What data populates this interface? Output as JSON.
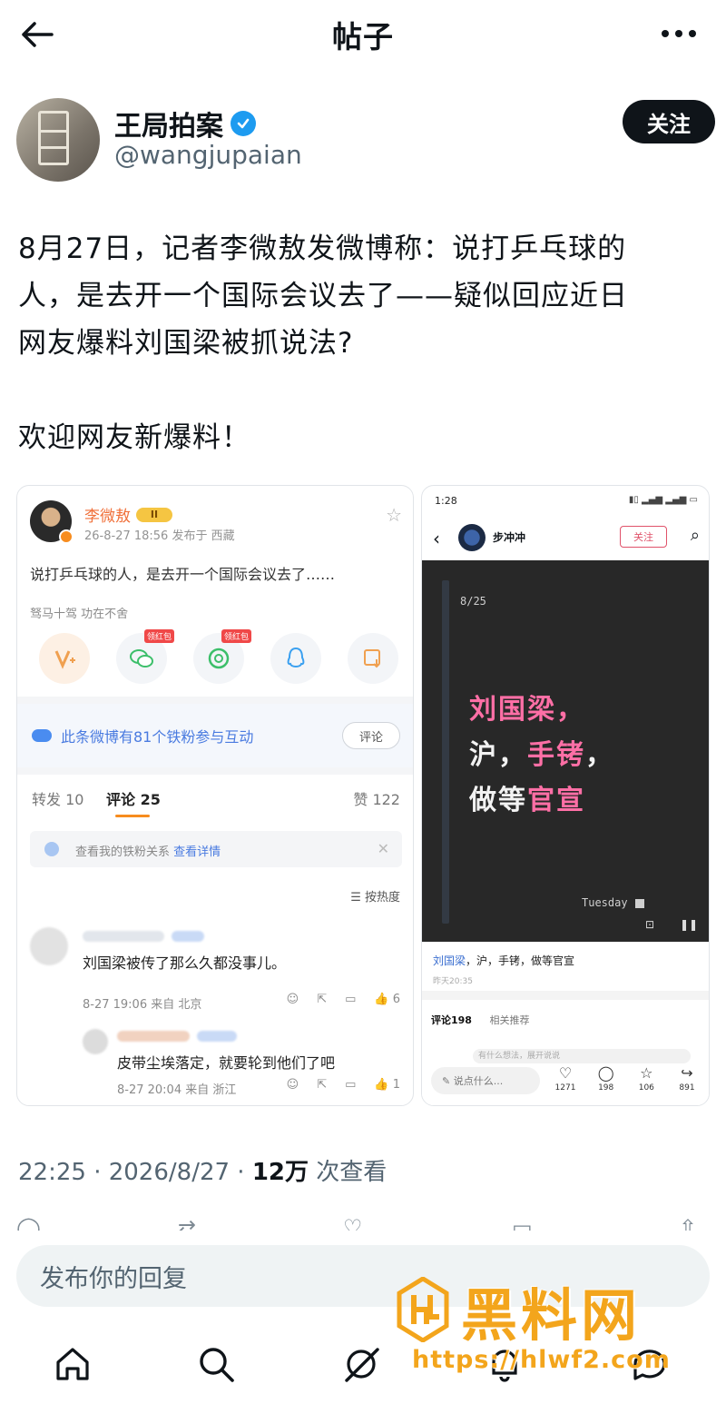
{
  "topbar": {
    "title": "帖子"
  },
  "author": {
    "name": "王局拍案",
    "handle": "@wangjupaian",
    "follow_label": "关注"
  },
  "post": {
    "lines": [
      "8月27日，记者李微敖发微博称：说打乒乓球的",
      "人，是去开一个国际会议去了——疑似回应近日",
      "网友爆料刘国梁被抓说法?"
    ],
    "line2": "欢迎网友新爆料！"
  },
  "weibo_card": {
    "name": "李微敖",
    "rank": "II",
    "meta": "26-8-27 18:56  发布于 西藏",
    "body": "说打乒乓球的人，是去开一个国际会议去了……",
    "sub": "驽马十驾 功在不舍",
    "tag1": "领红包",
    "tag2": "领红包",
    "fans_text": "此条微博有81个铁粉参与互动",
    "fans_btn": "评论",
    "tab_repost": "转发 10",
    "tab_comment": "评论 25",
    "tab_like": "赞 122",
    "fanrel_text": "查看我的铁粉关系",
    "fanrel_link": "查看详情",
    "sort": "按热度",
    "c1_text": "刘国梁被传了那么久都没事儿。",
    "c1_meta": "8-27 19:06  来自 北京",
    "c1_likes": "6",
    "c2_text": "皮带尘埃落定，就要轮到他们了吧",
    "c2_meta": "8-27 20:04  来自 浙江",
    "c2_likes": "1"
  },
  "phone_card": {
    "time": "1:28",
    "user": "步冲冲",
    "follow": "关注",
    "page": "8/25",
    "line1": "刘国梁，",
    "line2a": "沪，",
    "line2b": "手铐",
    "line2c": "，",
    "line3a": "做等",
    "line3b": "官宣",
    "day": "Tuesday",
    "caption_link": "刘国梁",
    "caption_rest": "，沪，手铐，做等官宣",
    "caption_time": "昨天20:35",
    "tab_comments": "评论198",
    "tab_related": "相关推荐",
    "ghost": "有什么想法，展开说说",
    "input": "说点什么...",
    "likes": "1271",
    "comments": "198",
    "stars": "106",
    "shares": "891"
  },
  "stamp": {
    "time": "22:25 · 2026/8/27 · ",
    "views": "12万",
    "suffix": " 次查看"
  },
  "composer": {
    "placeholder": "发布你的回复"
  },
  "watermark": {
    "brand": "黑料网",
    "url": "https://hlwf2.com"
  },
  "colors": {
    "accent": "#1d9bf0",
    "weibo_orange": "#f78c1e",
    "pink": "#ff6fa6",
    "watermark": "#f3a51c"
  }
}
